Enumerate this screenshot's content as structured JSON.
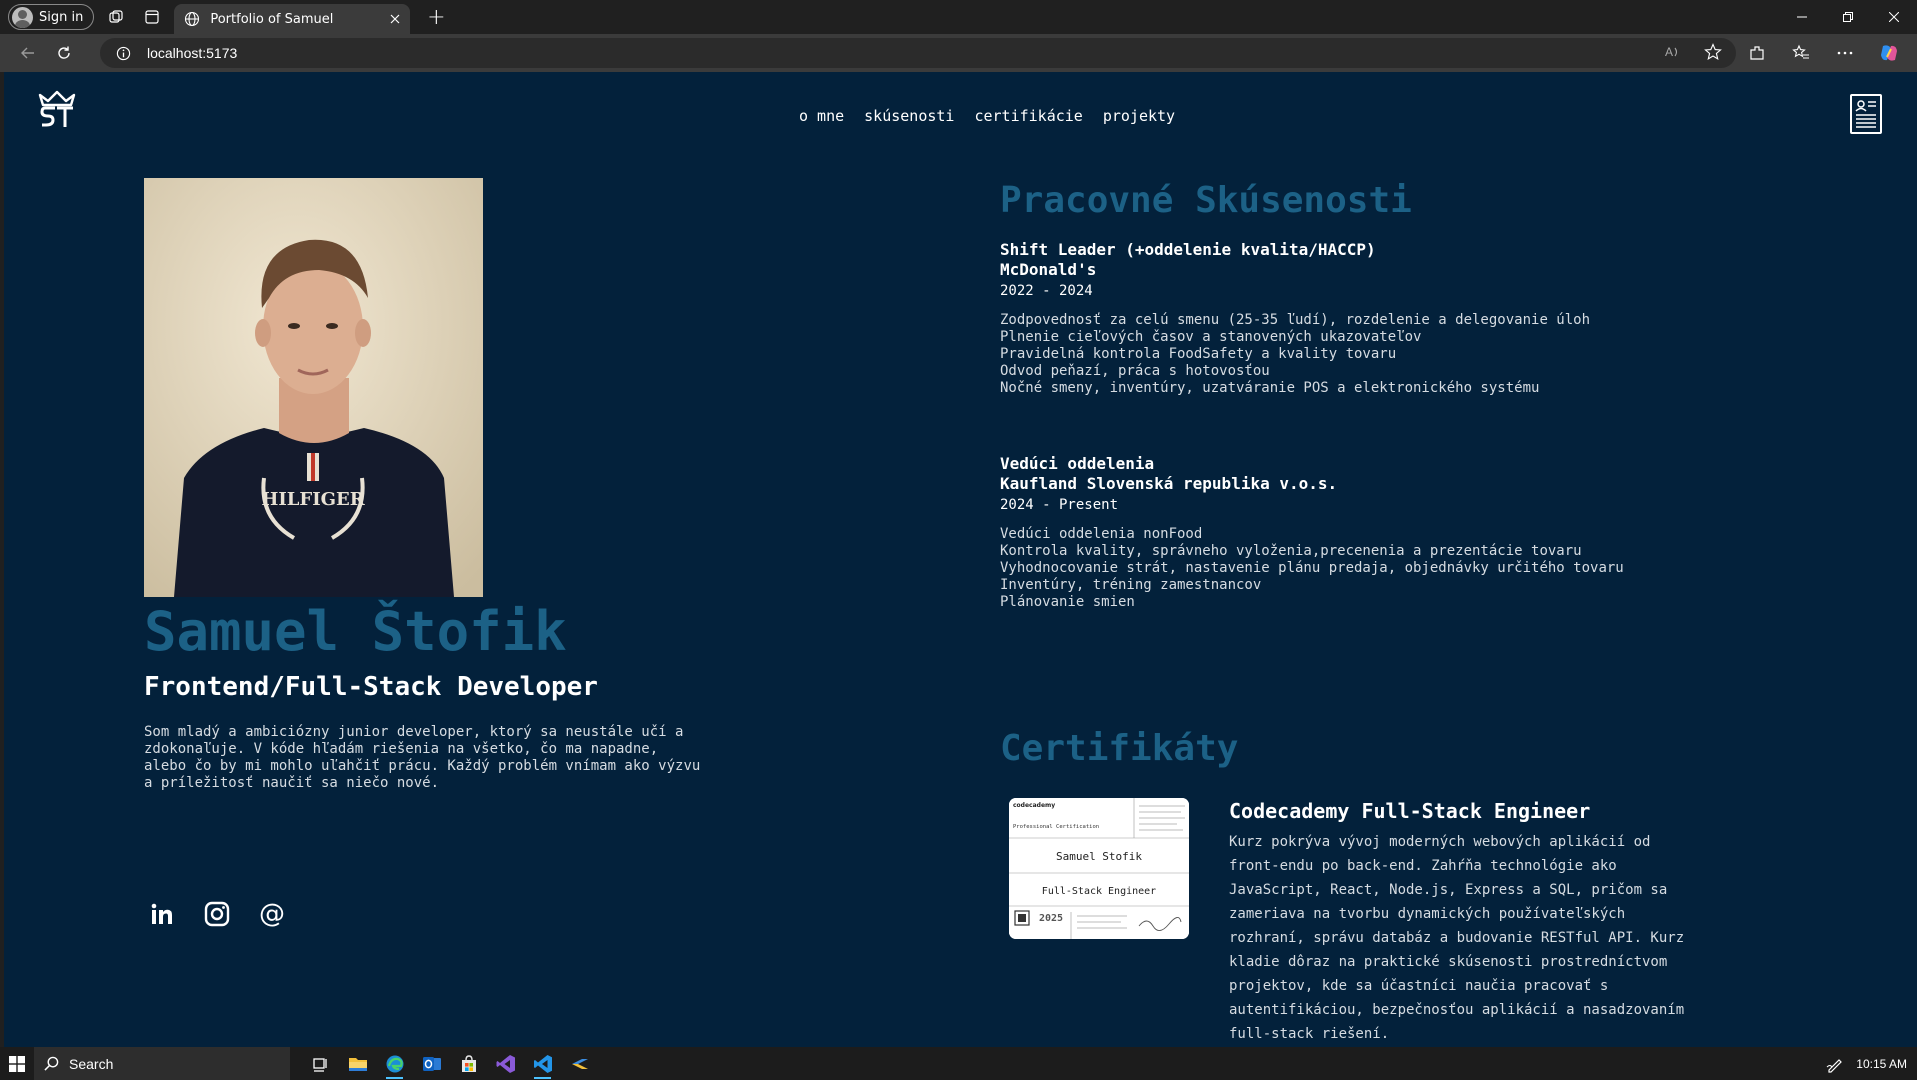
{
  "browser": {
    "signin_label": "Sign in",
    "tab_title": "Portfolio of Samuel",
    "url": "localhost:5173"
  },
  "nav": {
    "items": [
      {
        "label": "o mne"
      },
      {
        "label": "skúsenosti"
      },
      {
        "label": "certifikácie"
      },
      {
        "label": "projekty"
      }
    ]
  },
  "hero": {
    "name": "Samuel Štofik",
    "role": "Frontend/Full-Stack Developer",
    "bio": "Som mladý a ambiciózny junior developer, ktorý sa neustále učí a zdokonaľuje. V kóde hľadám riešenia na všetko, čo ma napadne, alebo čo by mi mohlo uľahčiť prácu. Každý problém vnímam ako výzvu a príležitosť naučiť sa niečo nové.",
    "tshirt_text": "HILFIGER"
  },
  "experience": {
    "heading": "Pracovné Skúsenosti",
    "jobs": [
      {
        "title": "Shift Leader (+oddelenie kvalita/HACCP)",
        "company": "McDonald's",
        "dates": "2022 - 2024",
        "bullets": [
          "Zodpovednosť za celú smenu (25-35 ľudí), rozdelenie a delegovanie úloh",
          "Plnenie cieľových časov a stanovených ukazovateľov",
          "Pravidelná kontrola FoodSafety a kvality tovaru",
          "Odvod peňazí, práca s hotovosťou",
          "Nočné smeny, inventúry, uzatváranie POS a elektronického systému"
        ]
      },
      {
        "title": "Vedúci oddelenia",
        "company": "Kaufland Slovenská republika v.o.s.",
        "dates": "2024 - Present",
        "bullets": [
          "Vedúci oddelenia nonFood",
          "Kontrola kvality, správneho vyloženia,precenenia a prezentácie tovaru",
          "Vyhodnocovanie strát, nastavenie plánu predaja, objednávky určitého tovaru",
          "Inventúry, tréning zamestnancov",
          "Plánovanie smien"
        ]
      }
    ]
  },
  "certificates": {
    "heading": "Certifikáty",
    "items": [
      {
        "title": "Codecademy Full-Stack Engineer",
        "description": "Kurz pokrýva vývoj moderných webových aplikácií od front-endu po back-end. Zahŕňa technológie ako JavaScript, React, Node.js, Express a SQL, pričom sa zameriava na tvorbu dynamických používateľských rozhraní, správu databáz a budovanie RESTful API. Kurz kladie dôraz na praktické skúsenosti prostredníctvom projektov, kde sa účastníci naučia pracovať s autentifikáciou, bezpečnosťou aplikácií a nasadzovaním full-stack riešení.",
        "image": {
          "brand": "codecademy",
          "label": "Professional Certification",
          "holder": "Samuel Stofik",
          "program": "Full-Stack Engineer",
          "year": "2025"
        }
      }
    ]
  },
  "taskbar": {
    "search_label": "Search",
    "time": "10:15 AM"
  },
  "colors": {
    "page_bg": "#03213b",
    "accent": "#1c6186",
    "text": "#ffffff"
  },
  "icons": {
    "socials": [
      "linkedin-icon",
      "instagram-icon",
      "at-email-icon"
    ],
    "cv": "resume-document-icon"
  }
}
